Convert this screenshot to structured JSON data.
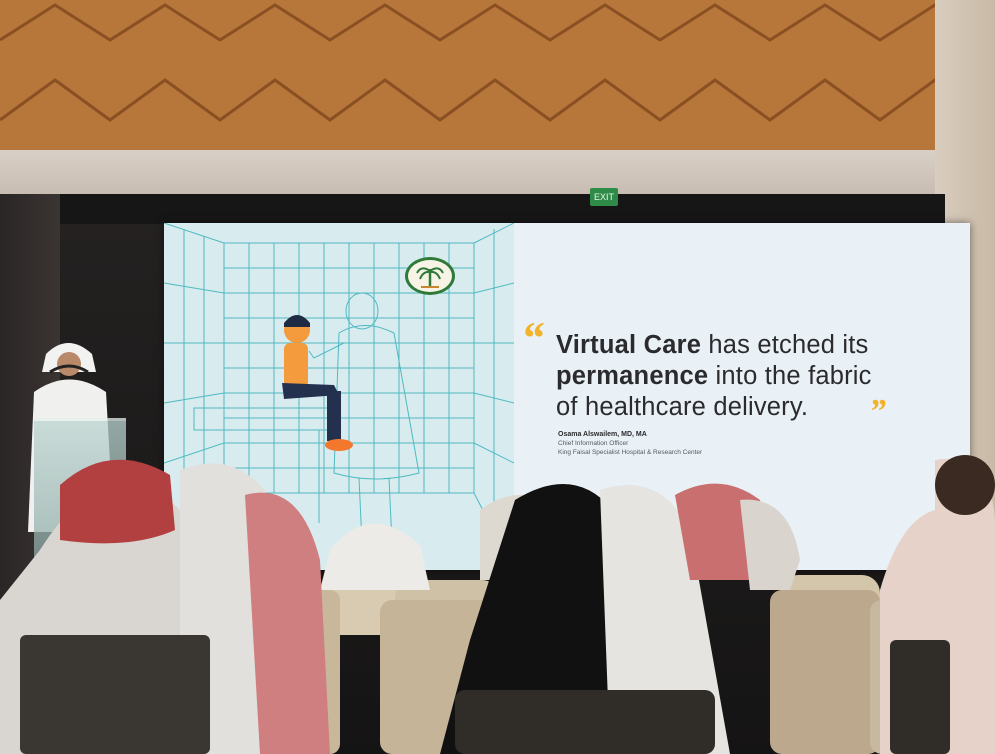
{
  "slide": {
    "quote_parts": {
      "bold1": "Virtual Care",
      "normal1": " has etched its",
      "bold2": "permanence",
      "normal2": " into the fabric",
      "normal3": "of healthcare delivery."
    },
    "attribution": {
      "name": "Osama Alswailem, MD, MA",
      "title": "Chief Information Officer",
      "org": "King Faisal Specialist Hospital & Research Center"
    },
    "accent_color": "#f2b32b",
    "grid_color": "#4fb9c2"
  },
  "scene": {
    "exit_sign_text": "EXIT"
  }
}
